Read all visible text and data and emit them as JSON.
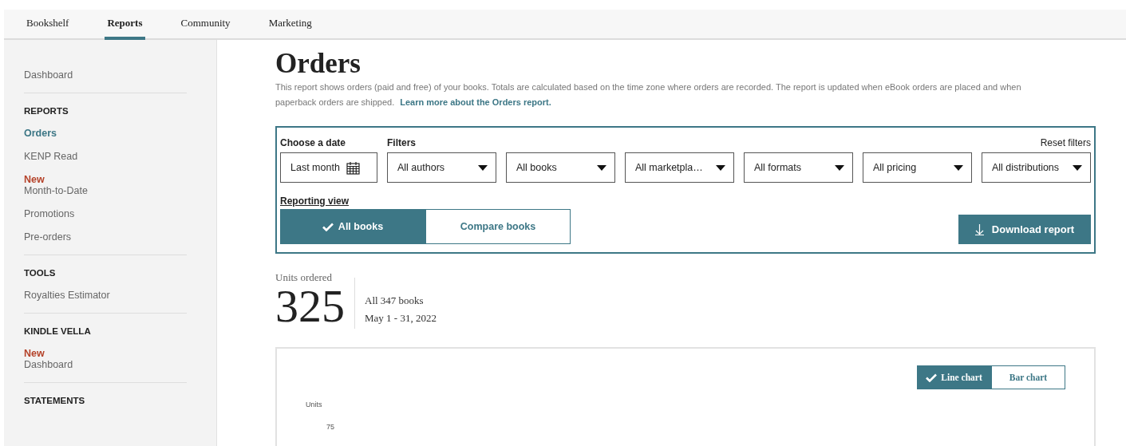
{
  "nav": {
    "tabs": [
      {
        "label": "Bookshelf",
        "selected": false
      },
      {
        "label": "Reports",
        "selected": true
      },
      {
        "label": "Community",
        "selected": false
      },
      {
        "label": "Marketing",
        "selected": false
      }
    ]
  },
  "sidebar": {
    "top_item": "Dashboard",
    "sections": [
      {
        "title": "REPORTS",
        "items": [
          {
            "label": "Orders",
            "selected": true
          },
          {
            "label": "KENP Read",
            "selected": false
          },
          {
            "label": "Month-to-Date",
            "badge": "New",
            "selected": false
          },
          {
            "label": "Promotions",
            "selected": false
          },
          {
            "label": "Pre-orders",
            "selected": false
          }
        ]
      },
      {
        "title": "TOOLS",
        "items": [
          {
            "label": "Royalties Estimator",
            "selected": false
          }
        ]
      },
      {
        "title": "KINDLE VELLA",
        "items": [
          {
            "label": "Dashboard",
            "badge": "New",
            "selected": false
          }
        ]
      },
      {
        "title": "STATEMENTS"
      }
    ]
  },
  "page": {
    "title": "Orders",
    "description": "This report shows orders (paid and free) of your books. Totals are calculated based on the time zone where orders are recorded. The report is updated when eBook orders are placed and when paperback orders are shipped.",
    "learn_more_link": "Learn more about the Orders report."
  },
  "filters": {
    "date_label": "Choose a date",
    "date_value": "Last month",
    "filters_label": "Filters",
    "reset": "Reset filters",
    "dropdowns": [
      "All authors",
      "All books",
      "All marketpla…",
      "All formats",
      "All pricing",
      "All distributions"
    ],
    "reporting_view_label": "Reporting view",
    "views": [
      {
        "label": "All books",
        "selected": true
      },
      {
        "label": "Compare books",
        "selected": false
      }
    ],
    "download": "Download report"
  },
  "summary": {
    "label": "Units ordered",
    "value": "325",
    "scope": "All 347 books",
    "period": "May 1 - 31, 2022"
  },
  "chart": {
    "types": [
      {
        "label": "Line chart",
        "selected": true
      },
      {
        "label": "Bar chart",
        "selected": false
      }
    ],
    "ylabel": "Units",
    "ytick": "75"
  }
}
